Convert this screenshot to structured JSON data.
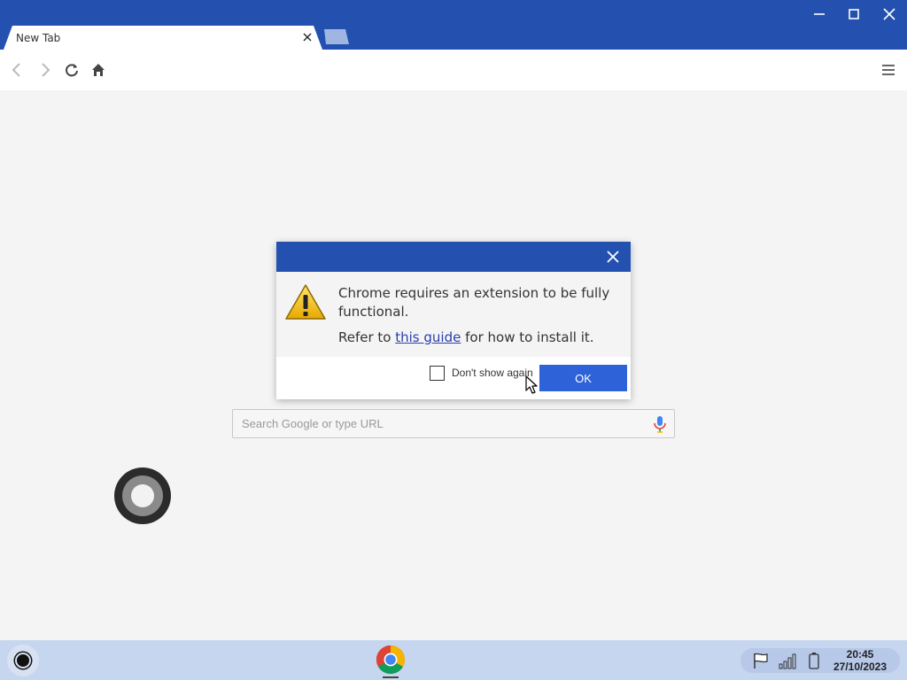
{
  "colors": {
    "titlebar": "#2451b0",
    "accent_button": "#2d62d9",
    "link": "#2a3fae",
    "taskbar": "#c7d6ef"
  },
  "browser": {
    "tab": {
      "title": "New Tab",
      "close_icon": "close-icon"
    },
    "new_tab_icon": "new-tab-icon",
    "window_controls": [
      "minimize-icon",
      "maximize-icon",
      "close-icon"
    ],
    "toolbar": [
      "back-icon",
      "forward-icon",
      "reload-icon",
      "home-icon",
      "menu-icon"
    ]
  },
  "search": {
    "placeholder": "Search Google or type URL",
    "value": "",
    "mic_icon": "microphone-icon"
  },
  "dialog": {
    "close_icon": "close-icon",
    "warning_icon": "warning-icon",
    "message": "Chrome requires an extension to be fully functional.",
    "ref_prefix": "Refer to ",
    "ref_link": "this guide",
    "ref_suffix": " for how to install it.",
    "checkbox_label": "Don't show again",
    "checkbox_checked": false,
    "ok_label": "OK"
  },
  "taskbar": {
    "launcher_icon": "launcher-icon",
    "pinned_app": "chrome-icon",
    "tray_icons": [
      "flag-icon",
      "signal-icon",
      "battery-icon"
    ],
    "time": "20:45",
    "date": "27/10/2023"
  }
}
